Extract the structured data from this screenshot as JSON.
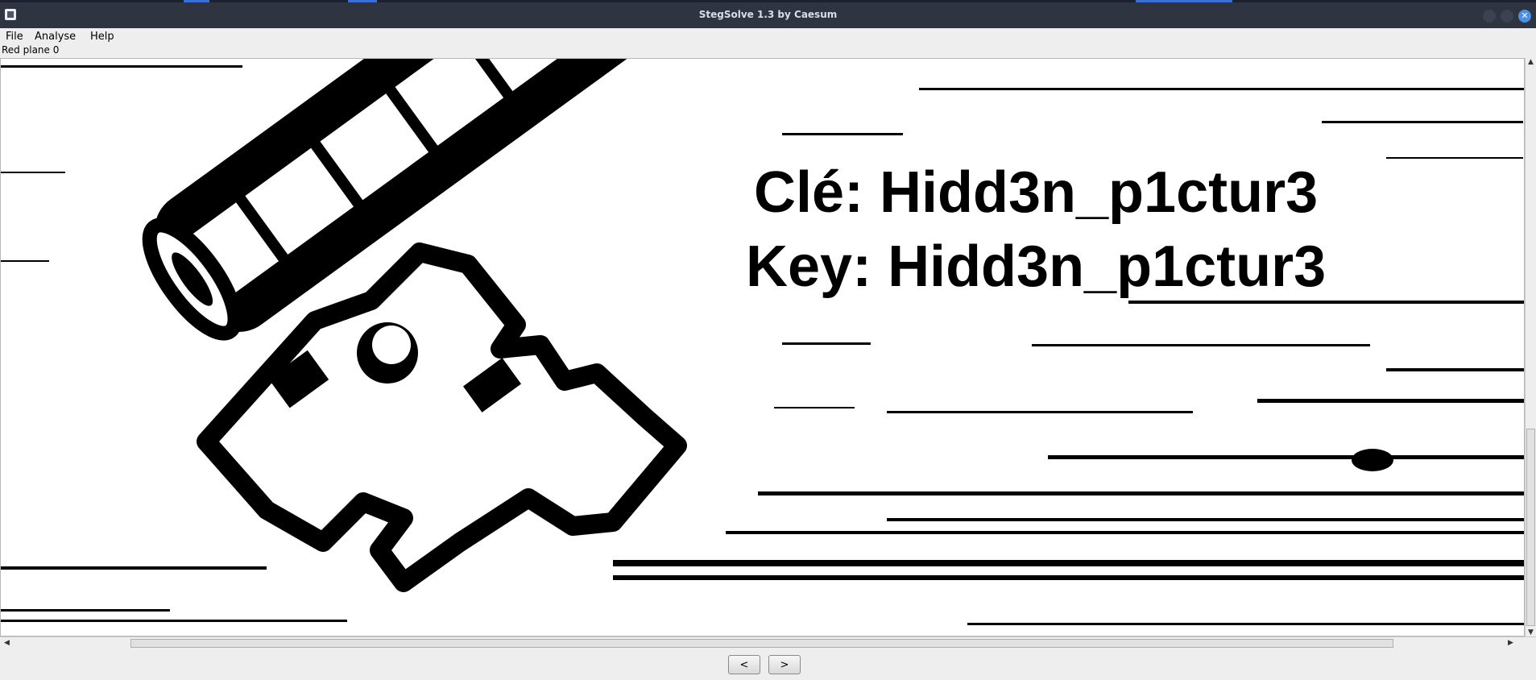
{
  "window": {
    "title": "StegSolve 1.3 by Caesum",
    "close_icon": "close-icon"
  },
  "menu": {
    "items": [
      {
        "label": "File"
      },
      {
        "label": "Analyse"
      },
      {
        "label": "Help"
      }
    ]
  },
  "plane_label": "Red plane 0",
  "image": {
    "line1": "Clé: Hidd3n_p1ctur3",
    "line2": "Key: Hidd3n_p1ctur3"
  },
  "nav": {
    "prev_label": "<",
    "next_label": ">"
  },
  "colors": {
    "titlebar": "#2e3440",
    "close_button": "#4a90e2",
    "window_bg": "#eeeeee"
  }
}
